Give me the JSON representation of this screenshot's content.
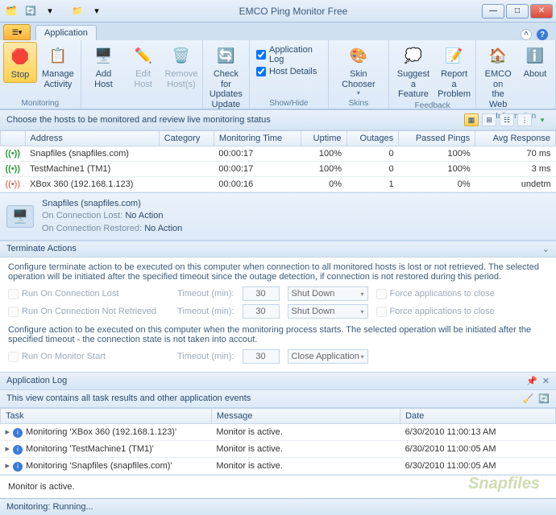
{
  "title": "EMCO Ping Monitor Free",
  "tabs": {
    "application": "Application"
  },
  "ribbon": {
    "stop": "Stop",
    "manage_activity": "Manage\nActivity",
    "monitoring_label": "Monitoring",
    "add_host": "Add Host",
    "edit_host": "Edit Host",
    "remove_host": "Remove\nHost(s)",
    "check_updates": "Check for\nUpdates\nUpdate",
    "app_log": "Application Log",
    "host_details": "Host Details",
    "showhide_label": "Show/Hide",
    "skin_chooser": "Skin Chooser",
    "skins_label": "Skins",
    "suggest": "Suggest a\nFeature",
    "report": "Report a\nProblem",
    "feedback_label": "Feedback",
    "emco_web": "EMCO on\nthe Web",
    "about": "About",
    "info_label": "Information"
  },
  "grid_caption": "Choose the hosts to be monitored and review live monitoring status",
  "grid_cols": {
    "addr": "Address",
    "cat": "Category",
    "mt": "Monitoring Time",
    "up": "Uptime",
    "out": "Outages",
    "pp": "Passed Pings",
    "ar": "Avg Response"
  },
  "grid_rows": [
    {
      "addr": "Snapfiles (snapfiles.com)",
      "mt": "00:00:17",
      "up": "100%",
      "out": "0",
      "pp": "100%",
      "ar": "70 ms"
    },
    {
      "addr": "TestMachine1 (TM1)",
      "mt": "00:00:17",
      "up": "100%",
      "out": "0",
      "pp": "100%",
      "ar": "3 ms"
    },
    {
      "addr": "XBox 360 (192.168.1.123)",
      "mt": "00:00:16",
      "up": "0%",
      "out": "1",
      "pp": "0%",
      "ar": "undetm"
    }
  ],
  "detail": {
    "name": "Snapfiles (snapfiles.com)",
    "on_lost_lbl": "On Connection Lost:",
    "on_lost_val": "No Action",
    "on_rest_lbl": "On Connection Restored:",
    "on_rest_val": "No Action"
  },
  "term": {
    "header": "Terminate Actions",
    "desc": "Configure terminate action to be executed on this computer when connection to all monitored hosts is lost or not retrieved. The selected operation will be initiated after the specified timeout since the outage detection, if connection is not restored during this period.",
    "run_lost": "Run On Connection Lost",
    "run_nr": "Run On Connection Not Retrieved",
    "timeout_lbl": "Timeout (min):",
    "timeout_val": "30",
    "action_shutdown": "Shut Down",
    "force": "Force applications to close",
    "desc2": "Configure action to be executed on this computer when the monitoring process starts. The selected operation will be initiated after the specified timeout - the connection state is not taken into accout.",
    "run_start": "Run On Monitor Start",
    "action_close": "Close Application"
  },
  "log": {
    "header": "Application Log",
    "sub": "This view contains all task results and other application events",
    "cols": {
      "task": "Task",
      "msg": "Message",
      "date": "Date"
    },
    "rows": [
      {
        "task": "Monitoring 'XBox 360 (192.168.1.123)'",
        "msg": "Monitor is active.",
        "date": "6/30/2010 11:00:13 AM"
      },
      {
        "task": "Monitoring 'TestMachine1 (TM1)'",
        "msg": "Monitor is active.",
        "date": "6/30/2010 11:00:05 AM"
      },
      {
        "task": "Monitoring 'Snapfiles (snapfiles.com)'",
        "msg": "Monitor is active.",
        "date": "6/30/2010 11:00:05 AM"
      }
    ]
  },
  "status_msg": "Monitor is active.",
  "watermark": "Snapfiles",
  "statusbar": "Monitoring: Running..."
}
